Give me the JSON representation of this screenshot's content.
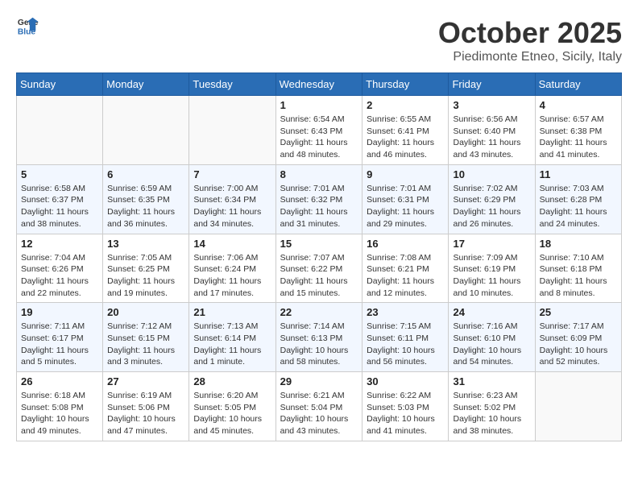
{
  "logo": {
    "text_general": "General",
    "text_blue": "Blue"
  },
  "header": {
    "month": "October 2025",
    "location": "Piedimonte Etneo, Sicily, Italy"
  },
  "days_of_week": [
    "Sunday",
    "Monday",
    "Tuesday",
    "Wednesday",
    "Thursday",
    "Friday",
    "Saturday"
  ],
  "weeks": [
    [
      {
        "day": "",
        "info": ""
      },
      {
        "day": "",
        "info": ""
      },
      {
        "day": "",
        "info": ""
      },
      {
        "day": "1",
        "info": "Sunrise: 6:54 AM\nSunset: 6:43 PM\nDaylight: 11 hours and 48 minutes."
      },
      {
        "day": "2",
        "info": "Sunrise: 6:55 AM\nSunset: 6:41 PM\nDaylight: 11 hours and 46 minutes."
      },
      {
        "day": "3",
        "info": "Sunrise: 6:56 AM\nSunset: 6:40 PM\nDaylight: 11 hours and 43 minutes."
      },
      {
        "day": "4",
        "info": "Sunrise: 6:57 AM\nSunset: 6:38 PM\nDaylight: 11 hours and 41 minutes."
      }
    ],
    [
      {
        "day": "5",
        "info": "Sunrise: 6:58 AM\nSunset: 6:37 PM\nDaylight: 11 hours and 38 minutes."
      },
      {
        "day": "6",
        "info": "Sunrise: 6:59 AM\nSunset: 6:35 PM\nDaylight: 11 hours and 36 minutes."
      },
      {
        "day": "7",
        "info": "Sunrise: 7:00 AM\nSunset: 6:34 PM\nDaylight: 11 hours and 34 minutes."
      },
      {
        "day": "8",
        "info": "Sunrise: 7:01 AM\nSunset: 6:32 PM\nDaylight: 11 hours and 31 minutes."
      },
      {
        "day": "9",
        "info": "Sunrise: 7:01 AM\nSunset: 6:31 PM\nDaylight: 11 hours and 29 minutes."
      },
      {
        "day": "10",
        "info": "Sunrise: 7:02 AM\nSunset: 6:29 PM\nDaylight: 11 hours and 26 minutes."
      },
      {
        "day": "11",
        "info": "Sunrise: 7:03 AM\nSunset: 6:28 PM\nDaylight: 11 hours and 24 minutes."
      }
    ],
    [
      {
        "day": "12",
        "info": "Sunrise: 7:04 AM\nSunset: 6:26 PM\nDaylight: 11 hours and 22 minutes."
      },
      {
        "day": "13",
        "info": "Sunrise: 7:05 AM\nSunset: 6:25 PM\nDaylight: 11 hours and 19 minutes."
      },
      {
        "day": "14",
        "info": "Sunrise: 7:06 AM\nSunset: 6:24 PM\nDaylight: 11 hours and 17 minutes."
      },
      {
        "day": "15",
        "info": "Sunrise: 7:07 AM\nSunset: 6:22 PM\nDaylight: 11 hours and 15 minutes."
      },
      {
        "day": "16",
        "info": "Sunrise: 7:08 AM\nSunset: 6:21 PM\nDaylight: 11 hours and 12 minutes."
      },
      {
        "day": "17",
        "info": "Sunrise: 7:09 AM\nSunset: 6:19 PM\nDaylight: 11 hours and 10 minutes."
      },
      {
        "day": "18",
        "info": "Sunrise: 7:10 AM\nSunset: 6:18 PM\nDaylight: 11 hours and 8 minutes."
      }
    ],
    [
      {
        "day": "19",
        "info": "Sunrise: 7:11 AM\nSunset: 6:17 PM\nDaylight: 11 hours and 5 minutes."
      },
      {
        "day": "20",
        "info": "Sunrise: 7:12 AM\nSunset: 6:15 PM\nDaylight: 11 hours and 3 minutes."
      },
      {
        "day": "21",
        "info": "Sunrise: 7:13 AM\nSunset: 6:14 PM\nDaylight: 11 hours and 1 minute."
      },
      {
        "day": "22",
        "info": "Sunrise: 7:14 AM\nSunset: 6:13 PM\nDaylight: 10 hours and 58 minutes."
      },
      {
        "day": "23",
        "info": "Sunrise: 7:15 AM\nSunset: 6:11 PM\nDaylight: 10 hours and 56 minutes."
      },
      {
        "day": "24",
        "info": "Sunrise: 7:16 AM\nSunset: 6:10 PM\nDaylight: 10 hours and 54 minutes."
      },
      {
        "day": "25",
        "info": "Sunrise: 7:17 AM\nSunset: 6:09 PM\nDaylight: 10 hours and 52 minutes."
      }
    ],
    [
      {
        "day": "26",
        "info": "Sunrise: 6:18 AM\nSunset: 5:08 PM\nDaylight: 10 hours and 49 minutes."
      },
      {
        "day": "27",
        "info": "Sunrise: 6:19 AM\nSunset: 5:06 PM\nDaylight: 10 hours and 47 minutes."
      },
      {
        "day": "28",
        "info": "Sunrise: 6:20 AM\nSunset: 5:05 PM\nDaylight: 10 hours and 45 minutes."
      },
      {
        "day": "29",
        "info": "Sunrise: 6:21 AM\nSunset: 5:04 PM\nDaylight: 10 hours and 43 minutes."
      },
      {
        "day": "30",
        "info": "Sunrise: 6:22 AM\nSunset: 5:03 PM\nDaylight: 10 hours and 41 minutes."
      },
      {
        "day": "31",
        "info": "Sunrise: 6:23 AM\nSunset: 5:02 PM\nDaylight: 10 hours and 38 minutes."
      },
      {
        "day": "",
        "info": ""
      }
    ]
  ]
}
